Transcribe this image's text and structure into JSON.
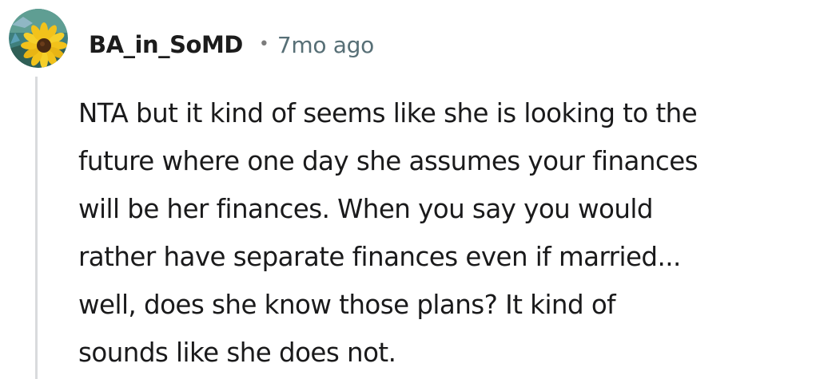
{
  "comment": {
    "author": "BA_in_SoMD",
    "separator": "•",
    "timestamp": "7mo ago",
    "avatar_icon": "sunflower-avatar-icon",
    "body_lines": [
      "NTA but it kind of seems like she is looking to the",
      "future where one day she assumes your finances",
      "will be her finances. When you say you would",
      "rather have separate finances even if married...",
      "well, does she know those plans? It kind of",
      "sounds like she does not."
    ]
  },
  "colors": {
    "username": "#1c1c1c",
    "timestamp": "#576f76",
    "body": "#1a1a1b",
    "thread_line": "#d9dbdd",
    "avatar_background": "#3e7f7c",
    "sunflower_petal": "#f2c21b",
    "sunflower_center": "#4a2a12"
  }
}
